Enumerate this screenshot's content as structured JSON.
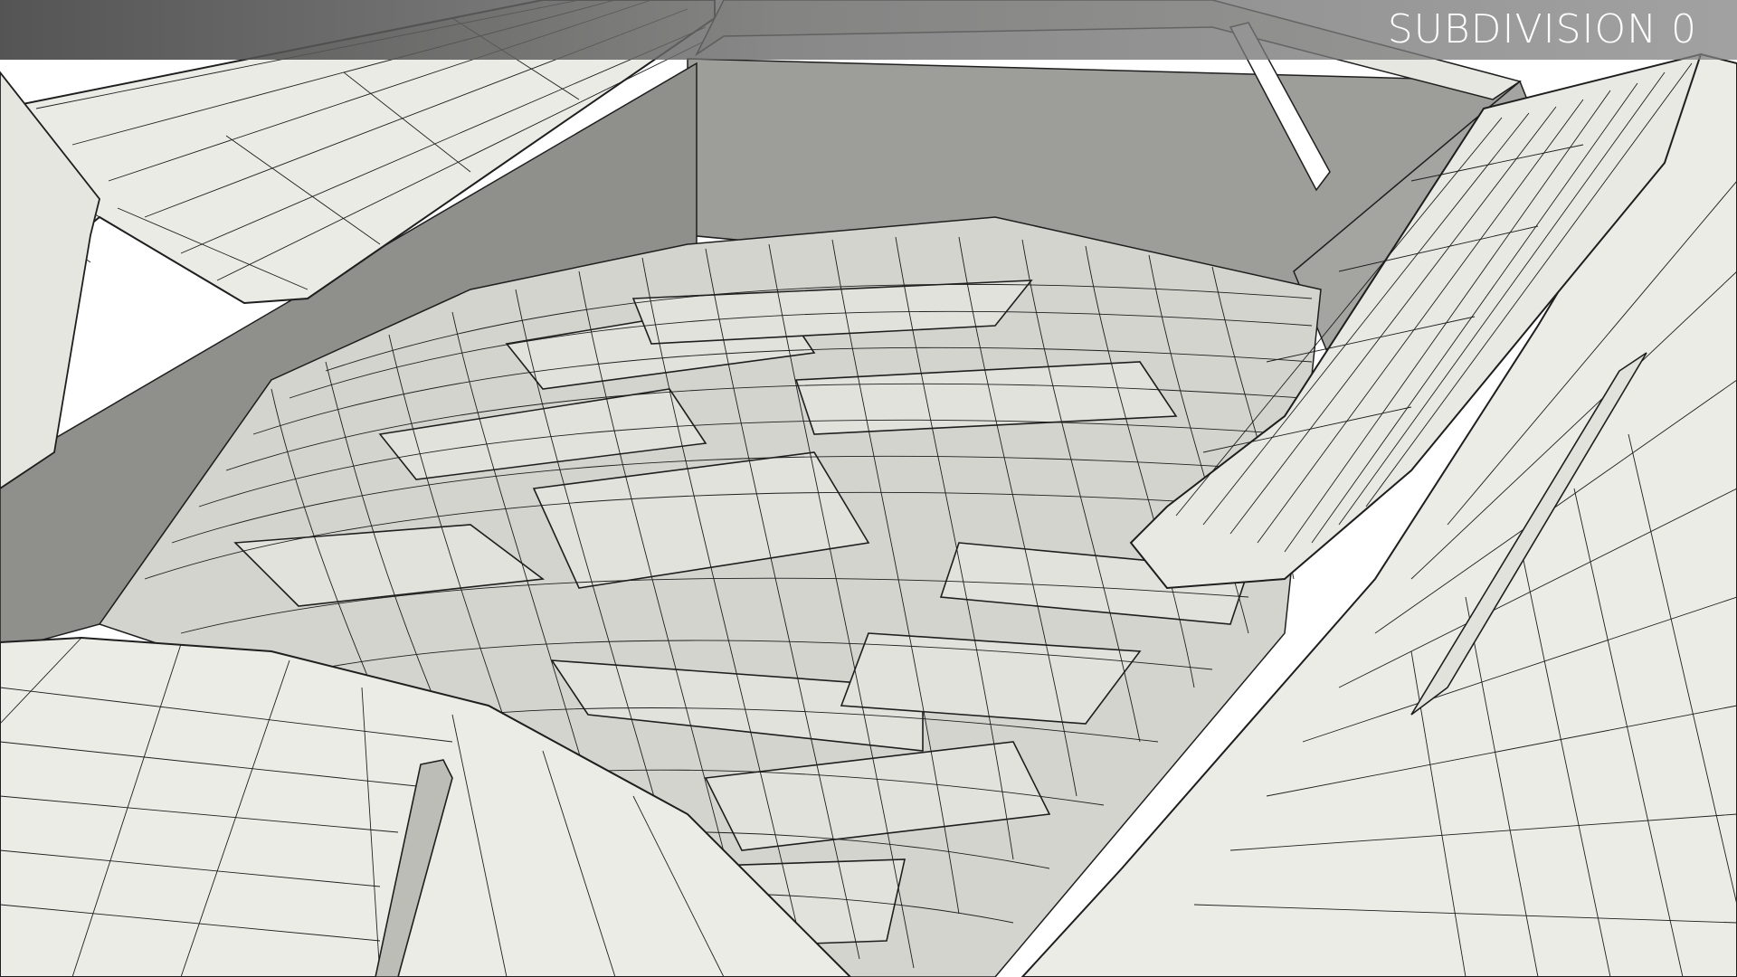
{
  "overlay": {
    "subdivision_label": "SUBDIVISION 0"
  },
  "render": {
    "colors": {
      "background": "#e9e9e4",
      "surface_light": "#ecece7",
      "surface_mid": "#d6d6d1",
      "surface_dark": "#a9a9a5",
      "wireframe": "#1e1e1e",
      "sky": "#ffffff"
    }
  }
}
